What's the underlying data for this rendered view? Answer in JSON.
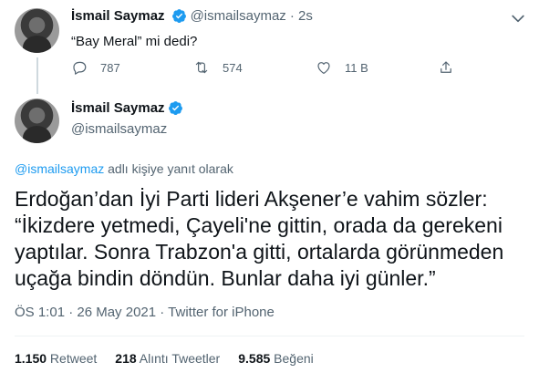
{
  "reply_tweet": {
    "name": "İsmail Saymaz",
    "handle": "@ismailsaymaz",
    "time": "· 2s",
    "text": "“Bay Meral” mi dedi?",
    "reply_count": "787",
    "retweet_count": "574",
    "like_count": "11 B"
  },
  "main_tweet": {
    "name": "İsmail Saymaz",
    "handle": "@ismailsaymaz",
    "replying_mention": "@ismailsaymaz",
    "replying_suffix": " adlı kişiye yanıt olarak",
    "text": "Erdoğan’dan İyi Parti lideri Akşener’e vahim sözler: “İkizdere yetmedi, Çayeli'ne gittin, orada da gerekeni yaptılar. Sonra Trabzon'a gitti, ortalarda görünmeden uçağa bindin döndün. Bunlar daha iyi günler.”",
    "meta": "ÖS 1:01 · 26 May 2021 · Twitter for iPhone",
    "stats": [
      {
        "value": "1.150",
        "label": " Retweet"
      },
      {
        "value": "218",
        "label": " Alıntı Tweetler"
      },
      {
        "value": "9.585",
        "label": " Beğeni"
      }
    ]
  },
  "colors": {
    "verified": "#1d9bf0",
    "link": "#1d9bf0",
    "secondary_text": "#536471"
  },
  "icons": [
    "more-icon",
    "verified-icon",
    "reply-icon",
    "retweet-icon",
    "like-icon",
    "share-icon"
  ]
}
